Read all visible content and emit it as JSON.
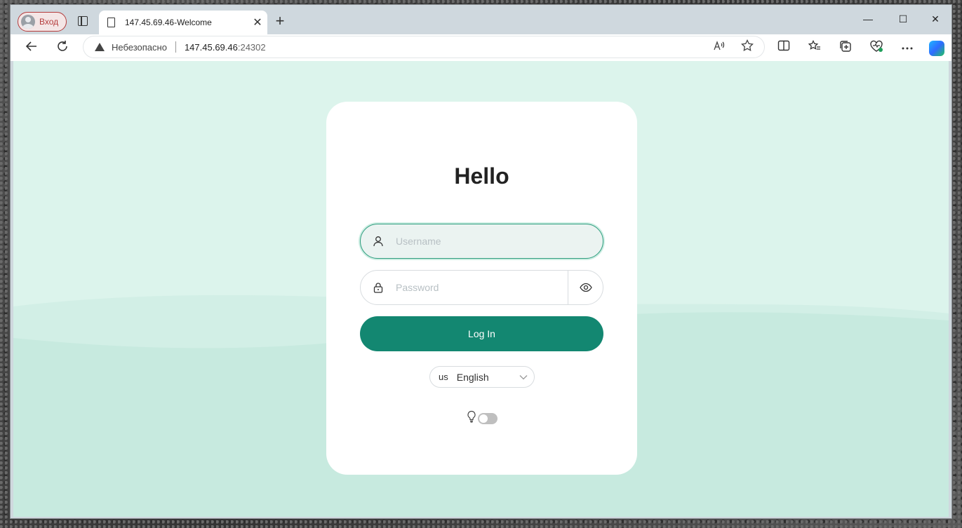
{
  "browser": {
    "profile_label": "Вход",
    "tab_title": "147.45.69.46-Welcome",
    "new_tab_symbol": "+",
    "close_tab_symbol": "✕",
    "window_controls": {
      "minimize": "—",
      "maximize": "☐",
      "close": "✕"
    },
    "address": {
      "security_text": "Небезопасно",
      "host": "147.45.69.46",
      "port": ":24302"
    },
    "icons": {
      "back": "arrow-left-icon",
      "reload": "reload-icon",
      "read_aloud": "read-aloud-icon",
      "favorite": "star-icon",
      "split": "split-screen-icon",
      "favorites": "favorites-icon",
      "collections": "collections-icon",
      "health": "browser-essentials-icon",
      "more": "more-icon",
      "copilot": "copilot-icon"
    }
  },
  "login": {
    "title": "Hello",
    "username_placeholder": "Username",
    "username_value": "",
    "password_placeholder": "Password",
    "password_value": "",
    "login_button": "Log In",
    "language": {
      "code": "us",
      "name": "English"
    },
    "theme_toggle_on": false
  },
  "colors": {
    "page_bg": "#dcf4ec",
    "wave": "#c9ebe0",
    "primary": "#138771",
    "focus_border": "#2f9d7e"
  }
}
